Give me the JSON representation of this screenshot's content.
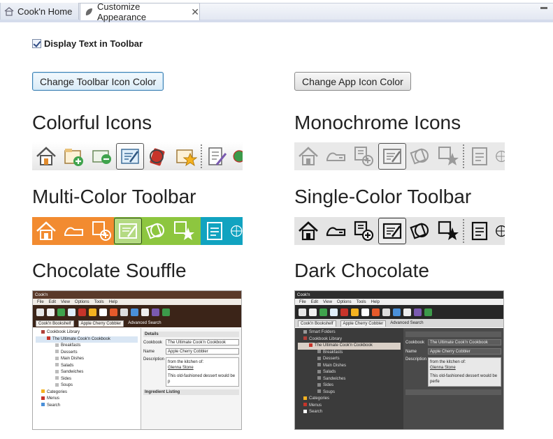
{
  "tabs": [
    {
      "label": "Cook'n Home",
      "icon": "home-icon"
    },
    {
      "label": "Customize Appearance",
      "icon": "cook-n-leaf-icon",
      "close": "✕"
    }
  ],
  "settings": {
    "display_text_label": "Display Text in Toolbar",
    "display_text_checked": true,
    "change_toolbar_btn": "Change Toolbar Icon Color",
    "change_app_btn": "Change App Icon Color"
  },
  "themes": {
    "colorful": "Colorful Icons",
    "monochrome": "Monochrome Icons",
    "multicolor": "Multi-Color Toolbar",
    "singlecolor": "Single-Color Toolbar",
    "chocolate_souffle": "Chocolate Souffle",
    "dark_chocolate": "Dark Chocolate"
  },
  "icon_names": [
    "home-icon",
    "recipe-card-icon",
    "add-folder-icon",
    "new-folder-icon",
    "edit-recipe-icon",
    "cookbook-icon",
    "favorites-icon",
    "edit-list-icon",
    "globe-icon"
  ],
  "colors": {
    "multi_orange": "#f28b30",
    "multi_green": "#8dc63f",
    "multi_teal": "#11a3c0",
    "accent_blue": "#3c7fb1"
  },
  "preview_choc": {
    "title": "Cook'n",
    "menu": [
      "File",
      "Edit",
      "View",
      "Options",
      "Tools",
      "Help"
    ],
    "tabs": [
      "Cook'n Bookshelf",
      "Apple Cherry Cobbler",
      "Advanced Search"
    ],
    "tree": [
      {
        "label": "Cookbook Library",
        "level": 1
      },
      {
        "label": "The Ultimate Cook'n Cookbook",
        "level": 2
      },
      {
        "label": "Breakfasts",
        "level": 3
      },
      {
        "label": "Desserts",
        "level": 3
      },
      {
        "label": "Main Dishes",
        "level": 3
      },
      {
        "label": "Salads",
        "level": 3
      },
      {
        "label": "Sandwiches",
        "level": 3
      },
      {
        "label": "Sides",
        "level": 3
      },
      {
        "label": "Soups",
        "level": 3
      },
      {
        "label": "Categories",
        "level": 1
      },
      {
        "label": "Menus",
        "level": 1
      },
      {
        "label": "Search",
        "level": 1
      }
    ],
    "details_header": "Details",
    "cookbook_label": "Cookbook",
    "cookbook_value": "The Ultimate Cook'n Cookbook",
    "name_label": "Name",
    "name_value": "Apple Cherry Cobbler",
    "description_label": "Description",
    "desc_line1": "from the kitchen of:",
    "desc_line2": "Glenna Stone",
    "desc_line3": "This old-fashioned dessert would be p",
    "ingredient_header": "Ingredient Listing"
  },
  "preview_dark": {
    "title": "Cook'n",
    "menu": [
      "File",
      "Edit",
      "View",
      "Options",
      "Tools",
      "Help"
    ],
    "tabs": [
      "Cook'n Bookshelf",
      "Apple Cherry Cobbler",
      "Advanced Search"
    ],
    "tree": [
      {
        "label": "Smart Folders",
        "level": 1
      },
      {
        "label": "Cookbook Library",
        "level": 1
      },
      {
        "label": "The Ultimate Cook'n Cookbook",
        "level": 2
      },
      {
        "label": "Breakfasts",
        "level": 3
      },
      {
        "label": "Desserts",
        "level": 3
      },
      {
        "label": "Main Dishes",
        "level": 3
      },
      {
        "label": "Salads",
        "level": 3
      },
      {
        "label": "Sandwiches",
        "level": 3
      },
      {
        "label": "Sides",
        "level": 3
      },
      {
        "label": "Soups",
        "level": 3
      },
      {
        "label": "Categories",
        "level": 1
      },
      {
        "label": "Menus",
        "level": 1
      },
      {
        "label": "Search",
        "level": 1
      }
    ],
    "cookbook_label": "Cookbook",
    "cookbook_value": "The Ultimate Cook'n Cookbook",
    "name_label": "Name",
    "name_value": "Apple Cherry Cobbler",
    "description_label": "Description",
    "desc_line1": "from the kitchen of:",
    "desc_line2": "Glenna Stone",
    "desc_line3": "This old-fashioned dessert would be perfe"
  }
}
